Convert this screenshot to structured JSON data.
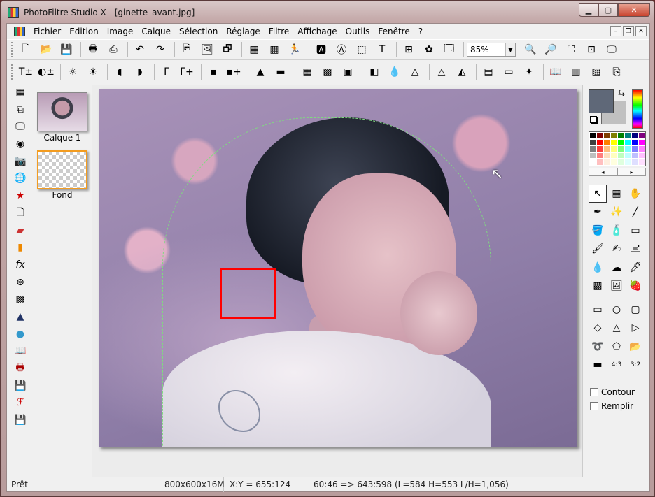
{
  "window": {
    "title": "PhotoFiltre Studio X - [ginette_avant.jpg]",
    "controls": {
      "minimize": "▁",
      "maximize": "▢",
      "close": "✕"
    }
  },
  "menubar": {
    "items": [
      "Fichier",
      "Edition",
      "Image",
      "Calque",
      "Sélection",
      "Réglage",
      "Filtre",
      "Affichage",
      "Outils",
      "Fenêtre",
      "?"
    ],
    "mdi": [
      "–",
      "❐",
      "✕"
    ]
  },
  "toolbar1": {
    "icons": [
      "new-file-icon",
      "open-folder-icon",
      "save-icon",
      "print-icon",
      "scanner-icon",
      "undo-icon",
      "redo-icon",
      "copy-image-icon",
      "paste-image-icon",
      "paste-new-icon",
      "gradient-icon",
      "palette-icon",
      "run-icon",
      "text-frame-icon",
      "color-text-icon",
      "selection-icon",
      "text-icon",
      "hierarchy-icon",
      "stamp-icon",
      "window-icon"
    ],
    "zoom_value": "85%",
    "zoom_icons": [
      "zoom-in-icon",
      "zoom-out-icon",
      "fit-window-icon",
      "actual-size-icon",
      "fullscreen-icon"
    ]
  },
  "toolbar2": {
    "icons": [
      "auto-levels-icon",
      "auto-contrast-icon",
      "brightness-down-icon",
      "brightness-up-icon",
      "contrast-down-icon",
      "contrast-up-icon",
      "gamma-down-icon",
      "gamma-up-icon",
      "saturation-down-icon",
      "saturation-up-icon",
      "levels-icon",
      "color-balance-icon",
      "pixelate-icon",
      "mosaic-icon",
      "texture-icon",
      "blur-icon",
      "drop-icon",
      "sharpen-icon",
      "triangle-icon",
      "triangle2-icon",
      "grid-color-icon",
      "monitor-icon",
      "stamp2-icon",
      "book-icon",
      "columns-icon",
      "frame-icon",
      "export-icon"
    ]
  },
  "left_tools": [
    "calculator-icon",
    "layers-icon",
    "monitor-icon",
    "sphere-icon",
    "camera-icon",
    "globe-icon",
    "star-icon",
    "page-icon",
    "gradient-fill-icon",
    "gradient-bar-icon",
    "fx-icon",
    "film-icon",
    "mosaic-icon",
    "histogram-icon",
    "circle-icon",
    "book-icon",
    "print-icon",
    "save-2000-icon",
    "script-icon",
    "save-html-icon"
  ],
  "layers": {
    "items": [
      {
        "label": "Calque 1"
      },
      {
        "label": "Fond"
      }
    ]
  },
  "palette": {
    "fg": "#5f6878",
    "bg": "#c0c0c0",
    "colors": [
      "#000000",
      "#7f0000",
      "#7f3f00",
      "#7f7f00",
      "#007f00",
      "#007f7f",
      "#00007f",
      "#7f007f",
      "#3f3f3f",
      "#ff0000",
      "#ff7f00",
      "#ffff00",
      "#00ff00",
      "#00ffff",
      "#0000ff",
      "#ff00ff",
      "#7f7f7f",
      "#ff3f3f",
      "#ffbf7f",
      "#ffff7f",
      "#7fff7f",
      "#7fffff",
      "#7f7fff",
      "#ff7fff",
      "#bfbfbf",
      "#ff7f7f",
      "#ffdfbf",
      "#ffffbf",
      "#bfffbf",
      "#bfffff",
      "#bfbfff",
      "#ffbfff",
      "#ffffff",
      "#ffbfbf",
      "#ffefdf",
      "#ffffdf",
      "#dfffdf",
      "#dfffff",
      "#dfdfff",
      "#ffdfff"
    ],
    "nav_left": "◂",
    "nav_right": "▸"
  },
  "tools": {
    "items": [
      "arrow-icon",
      "image-select-icon",
      "hand-icon",
      "eyedropper-icon",
      "magic-wand-icon",
      "line-icon",
      "paint-bucket-icon",
      "spray-icon",
      "eraser-icon",
      "brush-icon",
      "fx-brush-icon",
      "stamp-tool-icon",
      "blur-tool-icon",
      "smudge-icon",
      "clone-icon",
      "warp-icon",
      "portrait-icon",
      "strawberry-icon"
    ],
    "glyphs": [
      "↖",
      "▦",
      "✋",
      "✒",
      "✨",
      "╱",
      "🪣",
      "🧴",
      "▭",
      "🖌",
      "✍",
      "🖃",
      "💧",
      "☁",
      "🖊",
      "▩",
      "🖼",
      "🍓"
    ]
  },
  "shapes": {
    "items": [
      "rectangle-icon",
      "ellipse-icon",
      "rounded-rect-icon",
      "diamond-icon",
      "triangle-up-icon",
      "triangle-right-icon",
      "lasso-icon",
      "polygon-icon",
      "open-folder-shape-icon",
      "ratio-free-icon",
      "ratio-4-3-icon",
      "ratio-3-2-icon"
    ],
    "glyphs": [
      "▭",
      "○",
      "▢",
      "◇",
      "△",
      "▷",
      "➰",
      "⬠",
      "📂",
      "▬",
      "4:3",
      "3:2"
    ]
  },
  "options": {
    "contour": "Contour",
    "remplir": "Remplir"
  },
  "status": {
    "state": "Prêt",
    "size": "800x600x16M",
    "coords": "X:Y = 655:124",
    "selection": "60:46 => 643:598 (L=584  H=553  L/H=1,056)"
  }
}
